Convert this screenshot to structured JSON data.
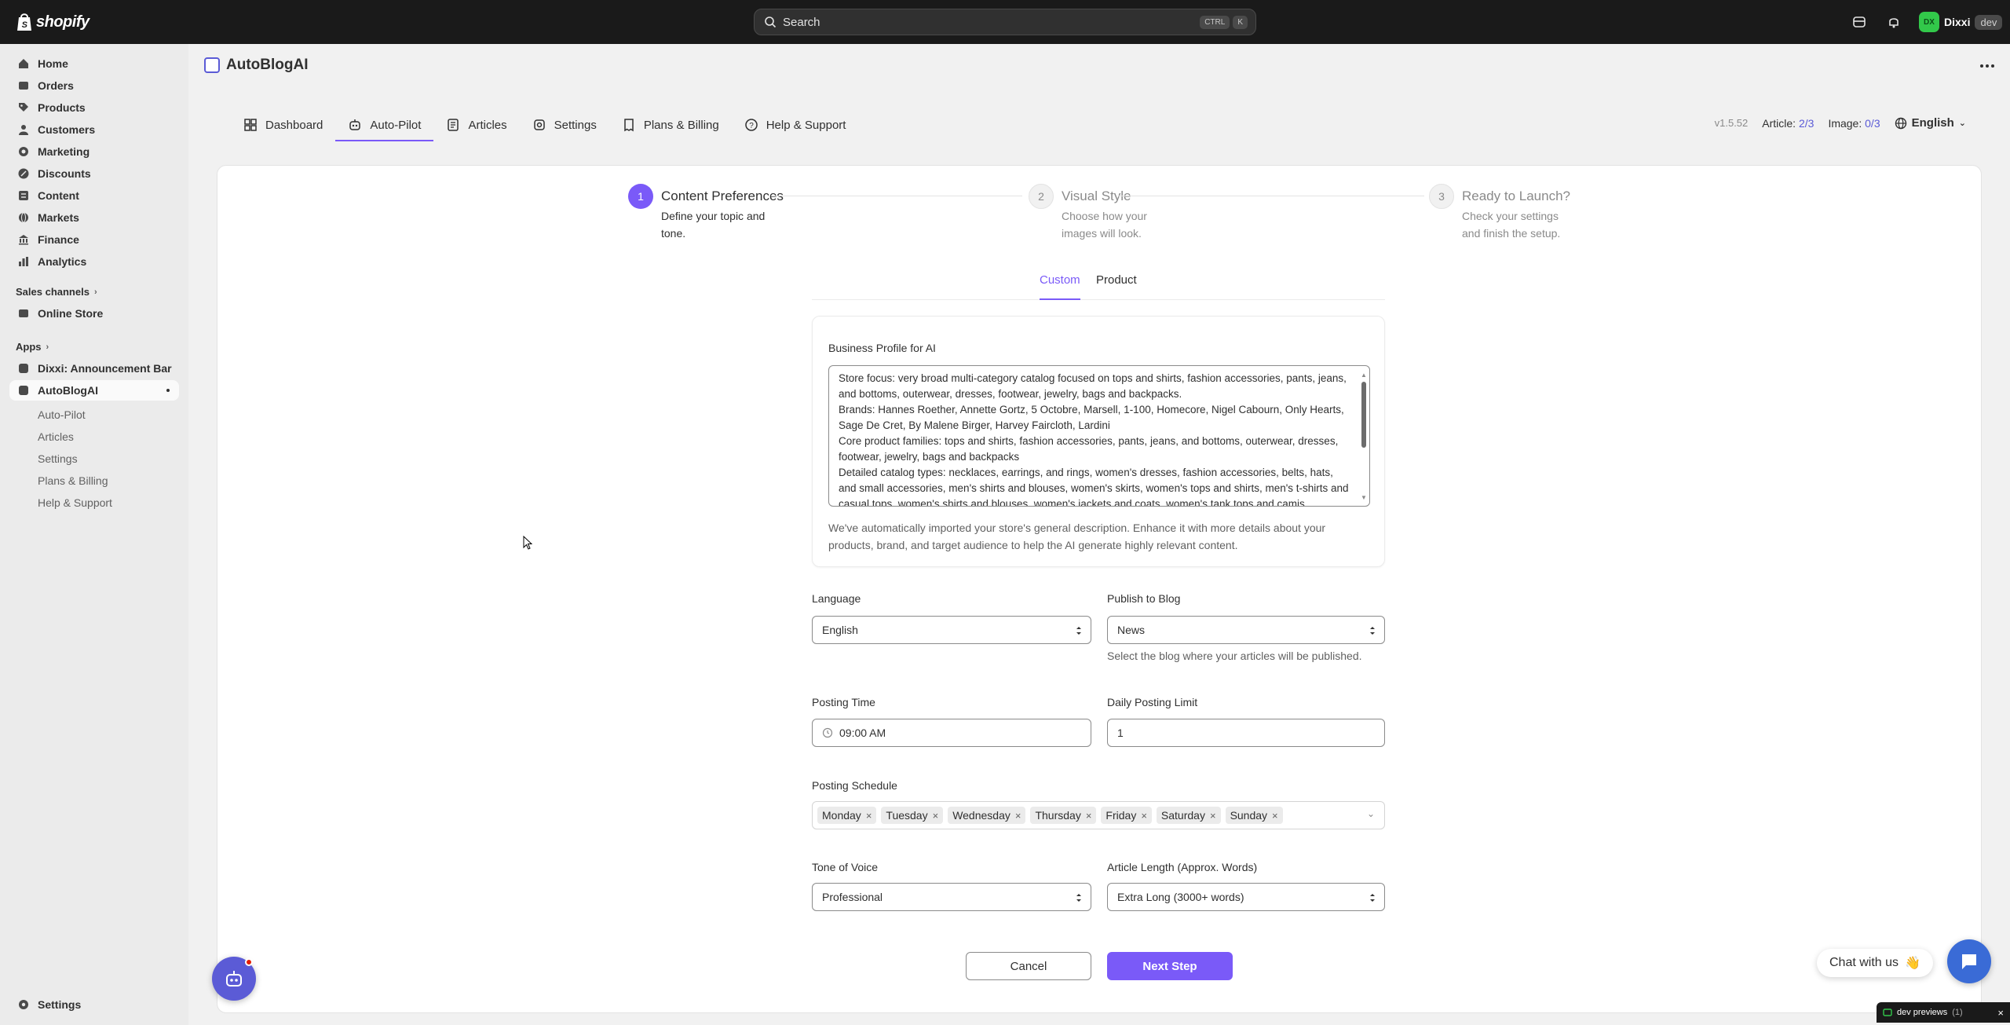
{
  "topbar": {
    "brand": "shopify",
    "search_placeholder": "Search",
    "shortcut": [
      "CTRL",
      "K"
    ],
    "store_initials": "DX",
    "store_name": "Dixxi",
    "store_badge": "dev"
  },
  "sidebar": {
    "items": [
      {
        "label": "Home",
        "icon": "home-icon"
      },
      {
        "label": "Orders",
        "icon": "orders-icon"
      },
      {
        "label": "Products",
        "icon": "tag-icon"
      },
      {
        "label": "Customers",
        "icon": "person-icon"
      },
      {
        "label": "Marketing",
        "icon": "target-icon"
      },
      {
        "label": "Discounts",
        "icon": "discount-icon"
      },
      {
        "label": "Content",
        "icon": "content-icon"
      },
      {
        "label": "Markets",
        "icon": "globe-icon"
      },
      {
        "label": "Finance",
        "icon": "bank-icon"
      },
      {
        "label": "Analytics",
        "icon": "chart-icon"
      }
    ],
    "sales_channels_label": "Sales channels",
    "online_store": "Online Store",
    "apps_label": "Apps",
    "app_announcement": "Dixxi: Announcement Bar",
    "app_autoblog": "AutoBlogAI",
    "app_sub": [
      "Auto-Pilot",
      "Articles",
      "Settings",
      "Plans & Billing",
      "Help & Support"
    ],
    "settings": "Settings"
  },
  "app": {
    "title": "AutoBlogAI",
    "tabs": [
      "Dashboard",
      "Auto-Pilot",
      "Articles",
      "Settings",
      "Plans & Billing",
      "Help & Support"
    ],
    "active_tab": "Auto-Pilot",
    "version": "v1.5.52",
    "article_label": "Article:",
    "article_value": "2/3",
    "image_label": "Image:",
    "image_value": "0/3",
    "language": "English"
  },
  "stepper": [
    {
      "num": "1",
      "title": "Content Preferences",
      "desc": "Define your topic and tone."
    },
    {
      "num": "2",
      "title": "Visual Style",
      "desc": "Choose how your images will look."
    },
    {
      "num": "3",
      "title": "Ready to Launch?",
      "desc": "Check your settings and finish the setup."
    }
  ],
  "subtabs": [
    "Custom",
    "Product"
  ],
  "profile": {
    "label": "Business Profile for AI",
    "text": "Store focus: very broad multi-category catalog focused on tops and shirts, fashion accessories, pants, jeans, and bottoms, outerwear, dresses, footwear, jewelry, bags and backpacks.\nBrands: Hannes Roether, Annette Gortz, 5 Octobre, Marsell, 1-100, Homecore, Nigel Cabourn, Only Hearts, Sage De Cret, By Malene Birger, Harvey Faircloth, Lardini\nCore product families: tops and shirts, fashion accessories, pants, jeans, and bottoms, outerwear, dresses, footwear, jewelry, bags and backpacks\nDetailed catalog types: necklaces, earrings, and rings, women's dresses, fashion accessories, belts, hats, and small accessories, men's shirts and blouses, women's skirts, women's tops and shirts, men's t-shirts and casual tops, women's shirts and blouses, women's jackets and coats, women's tank tops and camis,",
    "help": "We've automatically imported your store's general description. Enhance it with more details about your products, brand, and target audience to help the AI generate highly relevant content."
  },
  "form": {
    "language_label": "Language",
    "language_value": "English",
    "blog_label": "Publish to Blog",
    "blog_value": "News",
    "blog_hint": "Select the blog where your articles will be published.",
    "time_label": "Posting Time",
    "time_value": "09:00 AM",
    "limit_label": "Daily Posting Limit",
    "limit_value": "1",
    "schedule_label": "Posting Schedule",
    "schedule_days": [
      "Monday",
      "Tuesday",
      "Wednesday",
      "Thursday",
      "Friday",
      "Saturday",
      "Sunday"
    ],
    "tone_label": "Tone of Voice",
    "tone_value": "Professional",
    "length_label": "Article Length (Approx. Words)",
    "length_value": "Extra Long (3000+ words)"
  },
  "buttons": {
    "cancel": "Cancel",
    "next": "Next Step"
  },
  "chat": {
    "label": "Chat with us",
    "emoji": "👋"
  },
  "devbar": {
    "label": "dev previews",
    "count": "(1)"
  },
  "colors": {
    "accent": "#7a5af8",
    "topbar": "#1a1a1a",
    "sidebar": "#ebebeb"
  }
}
